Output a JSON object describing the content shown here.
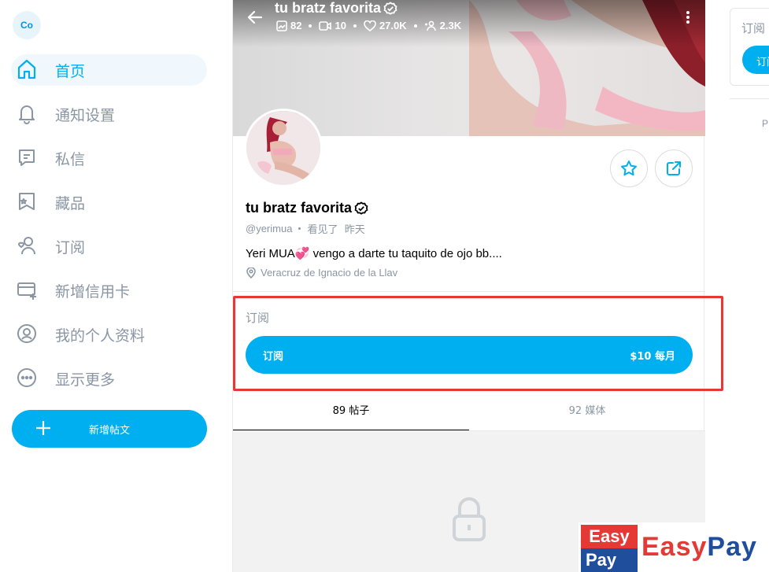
{
  "sidebar": {
    "avatar_initials": "Co",
    "items": [
      {
        "label": "首页",
        "icon": "home-icon",
        "active": true
      },
      {
        "label": "通知设置",
        "icon": "bell-icon"
      },
      {
        "label": "私信",
        "icon": "message-icon"
      },
      {
        "label": "藏品",
        "icon": "collections-icon"
      },
      {
        "label": "订阅",
        "icon": "subscriptions-icon"
      },
      {
        "label": "新增信用卡",
        "icon": "add-card-icon"
      },
      {
        "label": "我的个人资料",
        "icon": "profile-icon"
      },
      {
        "label": "显示更多",
        "icon": "more-icon"
      }
    ],
    "new_post_label": "新增帖文"
  },
  "cover": {
    "title": "tu bratz favorita",
    "stats": {
      "photos": "82",
      "videos": "10",
      "likes": "27.0K",
      "fans": "2.3K"
    }
  },
  "profile": {
    "name": "tu bratz favorita",
    "handle": "@yerimua",
    "last_seen": "看见了  昨天",
    "bio": "Yeri MUA💞 vengo a darte tu taquito de ojo bb....",
    "location": "Veracruz de Ignacio de la Llav"
  },
  "subscription": {
    "label": "订阅",
    "button_left": "订阅",
    "button_right": "$10 每月"
  },
  "tabs": [
    {
      "label": "89 帖子",
      "active": true
    },
    {
      "label": "92 媒体",
      "active": false
    }
  ],
  "right": {
    "card_label": "订阅",
    "button_label": "订阅",
    "footer_fragment": "P"
  },
  "watermark": {
    "box_top": "Easy",
    "box_bottom": "Pay",
    "text_easy": "Easy",
    "text_pay": "Pay"
  },
  "colors": {
    "accent": "#00aff0",
    "muted": "#8a96a3",
    "highlight_frame": "#e53935"
  }
}
